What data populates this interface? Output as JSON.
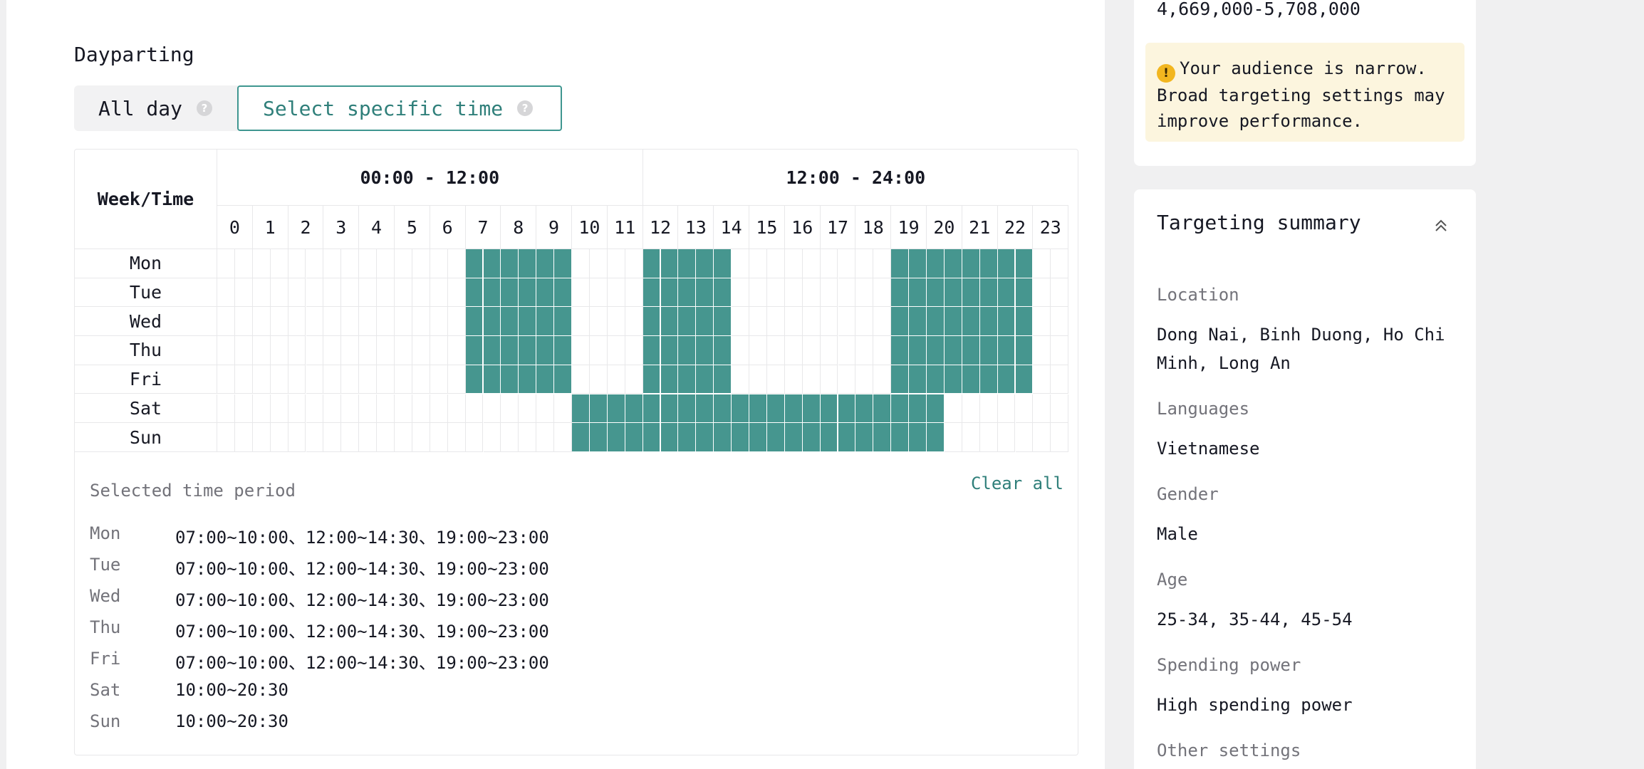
{
  "dayparting": {
    "title": "Dayparting",
    "mode_all_day": "All day",
    "mode_specific": "Select specific time",
    "help_glyph": "?"
  },
  "grid": {
    "corner_label": "Week/Time",
    "half_labels": [
      "00:00 - 12:00",
      "12:00 - 24:00"
    ],
    "hours": [
      "0",
      "1",
      "2",
      "3",
      "4",
      "5",
      "6",
      "7",
      "8",
      "9",
      "10",
      "11",
      "12",
      "13",
      "14",
      "15",
      "16",
      "17",
      "18",
      "19",
      "20",
      "21",
      "22",
      "23"
    ],
    "days": [
      "Mon",
      "Tue",
      "Wed",
      "Thu",
      "Fri",
      "Sat",
      "Sun"
    ],
    "selected_half_hour_ranges": [
      [
        [
          14,
          20
        ],
        [
          24,
          29
        ],
        [
          38,
          46
        ]
      ],
      [
        [
          14,
          20
        ],
        [
          24,
          29
        ],
        [
          38,
          46
        ]
      ],
      [
        [
          14,
          20
        ],
        [
          24,
          29
        ],
        [
          38,
          46
        ]
      ],
      [
        [
          14,
          20
        ],
        [
          24,
          29
        ],
        [
          38,
          46
        ]
      ],
      [
        [
          14,
          20
        ],
        [
          24,
          29
        ],
        [
          38,
          46
        ]
      ],
      [
        [
          20,
          41
        ]
      ],
      [
        [
          20,
          41
        ]
      ]
    ],
    "selected_color": "#46968f"
  },
  "selected_period": {
    "title": "Selected time period",
    "clear_all": "Clear all",
    "rows": [
      {
        "day": "Mon",
        "value": "07:00~10:00、12:00~14:30、19:00~23:00"
      },
      {
        "day": "Tue",
        "value": "07:00~10:00、12:00~14:30、19:00~23:00"
      },
      {
        "day": "Wed",
        "value": "07:00~10:00、12:00~14:30、19:00~23:00"
      },
      {
        "day": "Thu",
        "value": "07:00~10:00、12:00~14:30、19:00~23:00"
      },
      {
        "day": "Fri",
        "value": "07:00~10:00、12:00~14:30、19:00~23:00"
      },
      {
        "day": "Sat",
        "value": "10:00~20:30"
      },
      {
        "day": "Sun",
        "value": "10:00~20:30"
      }
    ]
  },
  "audience": {
    "reach": "4,669,000-5,708,000",
    "warning_icon": "!",
    "warning": "Your audience is narrow. Broad targeting settings may improve performance."
  },
  "summary": {
    "title": "Targeting summary",
    "collapse_icon": "double-chevron-up-icon",
    "items": [
      {
        "label": "Location",
        "value": "Dong Nai, Binh Duong, Ho Chi Minh, Long An"
      },
      {
        "label": "Languages",
        "value": "Vietnamese"
      },
      {
        "label": "Gender",
        "value": "Male"
      },
      {
        "label": "Age",
        "value": "25-34, 35-44, 45-54"
      },
      {
        "label": "Spending power",
        "value": "High spending power"
      },
      {
        "label": "Other settings",
        "value": ""
      }
    ]
  }
}
